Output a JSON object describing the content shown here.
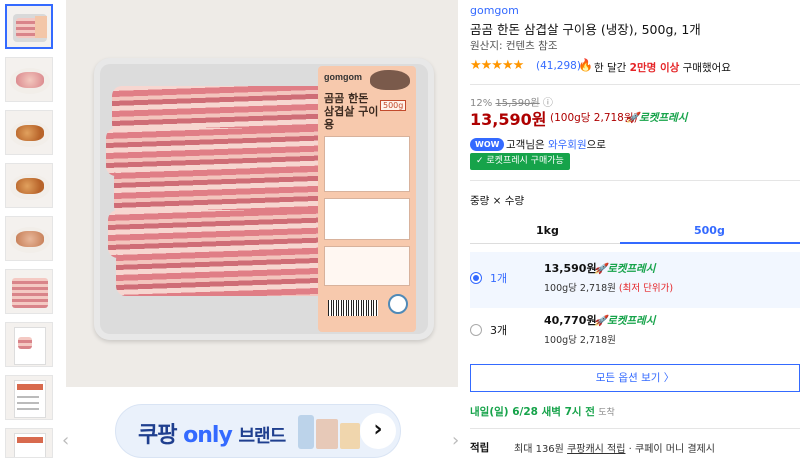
{
  "product": {
    "brand": "gomgom",
    "title": "곰곰 한돈 삼겹살 구이용 (냉장), 500g, 1개",
    "origin": "원산지: 컨텐츠 참조",
    "rating_stars": "★★★★★",
    "rating_value": 4.5,
    "review_count": "(41,298)",
    "buy_prefix": "한 달간",
    "buy_highlight": "2만명 이상",
    "buy_suffix": "구매했어요"
  },
  "image": {
    "package_brand": "gomgom",
    "package_title": "곰곰 한돈 삼겹살 구이용",
    "package_weight": "500g",
    "thumbnail_count": 9
  },
  "pricing": {
    "discount_pct": "12%",
    "original_price": "15,590원",
    "info_icon": "ⓘ",
    "price": "13,590원",
    "unit_price": "(100g당 2,718원)",
    "rocket_label": "로켓프레시"
  },
  "membership": {
    "wow_badge": "WOW",
    "text_prefix": "고객님은",
    "text_link": "와우회원",
    "text_suffix": "으로",
    "rocket_button": "✓ 로켓프레시 구매가능"
  },
  "options": {
    "label": "중량 × 수량",
    "tabs": [
      "1kg",
      "500g"
    ],
    "selected_tab": "500g",
    "items": [
      {
        "qty": "1개",
        "price": "13,590원",
        "rocket": "로켓프레시",
        "unit": "100g당 2,718원",
        "note": "(최저 단위가)",
        "selected": true
      },
      {
        "qty": "3개",
        "price": "40,770원",
        "rocket": "로켓프레시",
        "unit": "100g당 2,718원",
        "note": "",
        "selected": false
      }
    ],
    "more_button": "모든 옵션 보기 〉"
  },
  "delivery": {
    "text": "내일(일) 6/28 새벽 7시 전",
    "tail": "도착"
  },
  "points": {
    "label": "적립",
    "prefix": "최대 136원",
    "link": "쿠팡캐시 적립",
    "suffix": "· 쿠페이 머니 결제시"
  },
  "banner": {
    "prefix": "쿠팡",
    "only": "only",
    "suffix": "브랜드",
    "arrow": "›"
  },
  "nav": {
    "prev": "‹",
    "next": "›"
  },
  "colors": {
    "accent": "#346aff",
    "price": "#ae0000",
    "rocket": "#16a34a",
    "star": "#ff9600"
  }
}
